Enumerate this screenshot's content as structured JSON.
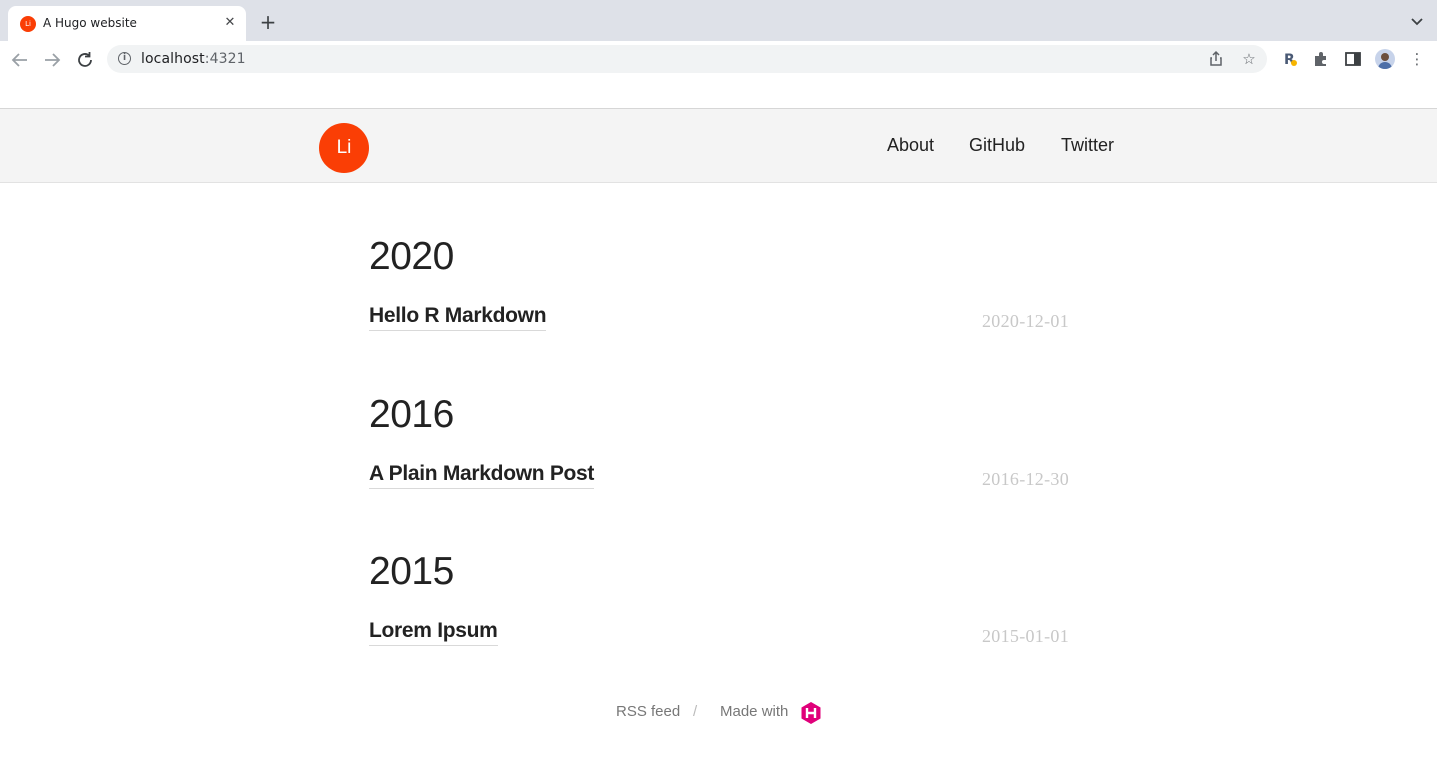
{
  "browser": {
    "tab_title": "A Hugo website",
    "tab_favicon_text": "Li",
    "url_host": "localhost",
    "url_port": ":4321",
    "icons": {
      "back": "arrow-left-icon",
      "forward": "arrow-right-icon",
      "reload": "reload-icon",
      "site_info": "info-icon",
      "share": "share-icon",
      "bookmark": "star-icon",
      "extension": "puzzle-icon",
      "side_panel": "side-panel-icon",
      "menu": "kebab-menu-icon"
    }
  },
  "site": {
    "logo_text": "Li",
    "accent_color": "#fa3e05",
    "nav": [
      {
        "label": "About"
      },
      {
        "label": "GitHub"
      },
      {
        "label": "Twitter"
      }
    ]
  },
  "archive": [
    {
      "year": "2020",
      "posts": [
        {
          "title": "Hello R Markdown",
          "date": "2020-12-01"
        }
      ]
    },
    {
      "year": "2016",
      "posts": [
        {
          "title": "A Plain Markdown Post",
          "date": "2016-12-30"
        }
      ]
    },
    {
      "year": "2015",
      "posts": [
        {
          "title": "Lorem Ipsum",
          "date": "2015-01-01"
        }
      ]
    }
  ],
  "footer": {
    "rss_label": "RSS feed",
    "separator": "/",
    "made_with_label": "Made with",
    "hugo_logo_color": "#ff4088"
  }
}
